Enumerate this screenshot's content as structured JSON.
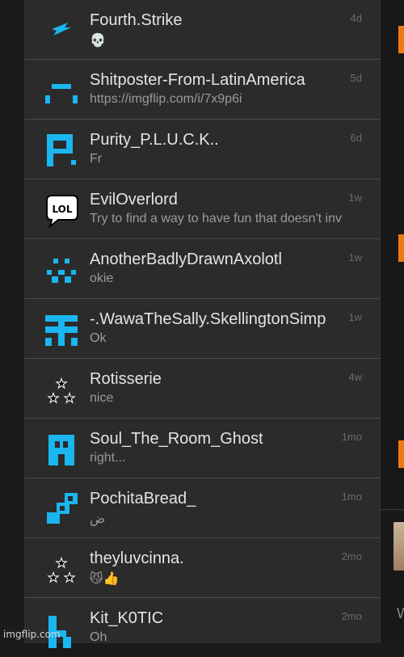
{
  "conversations": [
    {
      "name": "Fourth.Strike",
      "message": "💀",
      "time": "4d",
      "icon": "lightning-icon"
    },
    {
      "name": "Shitposter-From-LatinAmerica",
      "message": "https://imgflip.com/i/7x9p6i",
      "time": "5d",
      "icon": "pixel-face-icon"
    },
    {
      "name": "Purity_P.L.U.C.K..",
      "message": "Fr",
      "time": "6d",
      "icon": "pixel-letter-p-icon"
    },
    {
      "name": "EvilOverlord",
      "message": "Try to find a way to have fun that doesn't inv",
      "time": "1w",
      "icon": "lol-speech-bubble-icon"
    },
    {
      "name": "AnotherBadlyDrawnAxolotl",
      "message": "okie",
      "time": "1w",
      "icon": "pixel-checker-icon"
    },
    {
      "name": "-.WawaTheSally.SkellingtonSimp",
      "message": "Ok",
      "time": "1w",
      "icon": "pixel-hash-icon"
    },
    {
      "name": "Rotisserie",
      "message": "nice",
      "time": "4w",
      "icon": "stars-icon"
    },
    {
      "name": "Soul_The_Room_Ghost",
      "message": "right...",
      "time": "1mo",
      "icon": "pixel-ghost-icon"
    },
    {
      "name": "PochitaBread_",
      "message": "ض",
      "time": "1mo",
      "icon": "pixel-diagonal-icon"
    },
    {
      "name": "theyluvcinna.",
      "message": "😼👍",
      "time": "2mo",
      "icon": "stars-icon"
    },
    {
      "name": "Kit_K0TIC",
      "message": "Oh",
      "time": "2mo",
      "icon": "pixel-letter-k-icon"
    }
  ],
  "right_strip": {
    "glyph": "W"
  },
  "watermark": "imgflip.com",
  "colors": {
    "accent_pixel": "#1ab6f0",
    "orange": "#f07a12",
    "panel": "#2b2b2b"
  }
}
